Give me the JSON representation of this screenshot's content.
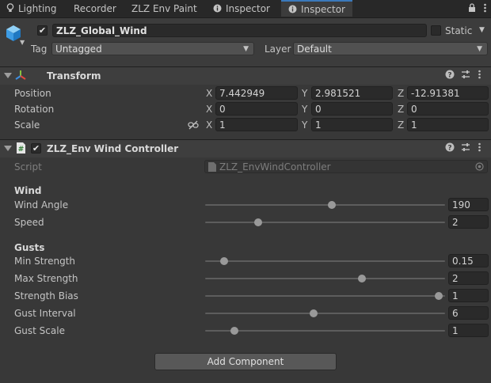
{
  "tabs": [
    {
      "label": "Lighting",
      "icon": "lightbulb-icon"
    },
    {
      "label": "Recorder",
      "icon": ""
    },
    {
      "label": "ZLZ Env Paint",
      "icon": ""
    },
    {
      "label": "Inspector",
      "icon": "info-icon"
    },
    {
      "label": "Inspector",
      "icon": "info-icon"
    }
  ],
  "header": {
    "object_name": "ZLZ_Global_Wind",
    "static_label": "Static",
    "tag_label": "Tag",
    "tag_value": "Untagged",
    "layer_label": "Layer",
    "layer_value": "Default"
  },
  "transform": {
    "title": "Transform",
    "rows": [
      {
        "label": "Position",
        "x": "7.442949",
        "y": "2.981521",
        "z": "-12.91381"
      },
      {
        "label": "Rotation",
        "x": "0",
        "y": "0",
        "z": "0"
      },
      {
        "label": "Scale",
        "x": "1",
        "y": "1",
        "z": "1"
      }
    ],
    "axis": {
      "x": "X",
      "y": "Y",
      "z": "Z"
    }
  },
  "wind_controller": {
    "title": "ZLZ_Env Wind Controller",
    "script_label": "Script",
    "script_value": "ZLZ_EnvWindController",
    "wind_header": "Wind",
    "gusts_header": "Gusts",
    "wind_fields": [
      {
        "label": "Wind Angle",
        "value": "190",
        "fraction": 0.53
      },
      {
        "label": "Speed",
        "value": "2",
        "fraction": 0.21
      }
    ],
    "gust_fields": [
      {
        "label": "Min Strength",
        "value": "0.15",
        "fraction": 0.065
      },
      {
        "label": "Max Strength",
        "value": "2",
        "fraction": 0.66
      },
      {
        "label": "Strength Bias",
        "value": "1",
        "fraction": 0.99
      },
      {
        "label": "Gust Interval",
        "value": "6",
        "fraction": 0.45
      },
      {
        "label": "Gust Scale",
        "value": "1",
        "fraction": 0.11
      }
    ]
  },
  "add_component_label": "Add Component",
  "colors": {
    "accent": "#3a79bb",
    "background": "#383838",
    "field": "#2a2a2a"
  }
}
